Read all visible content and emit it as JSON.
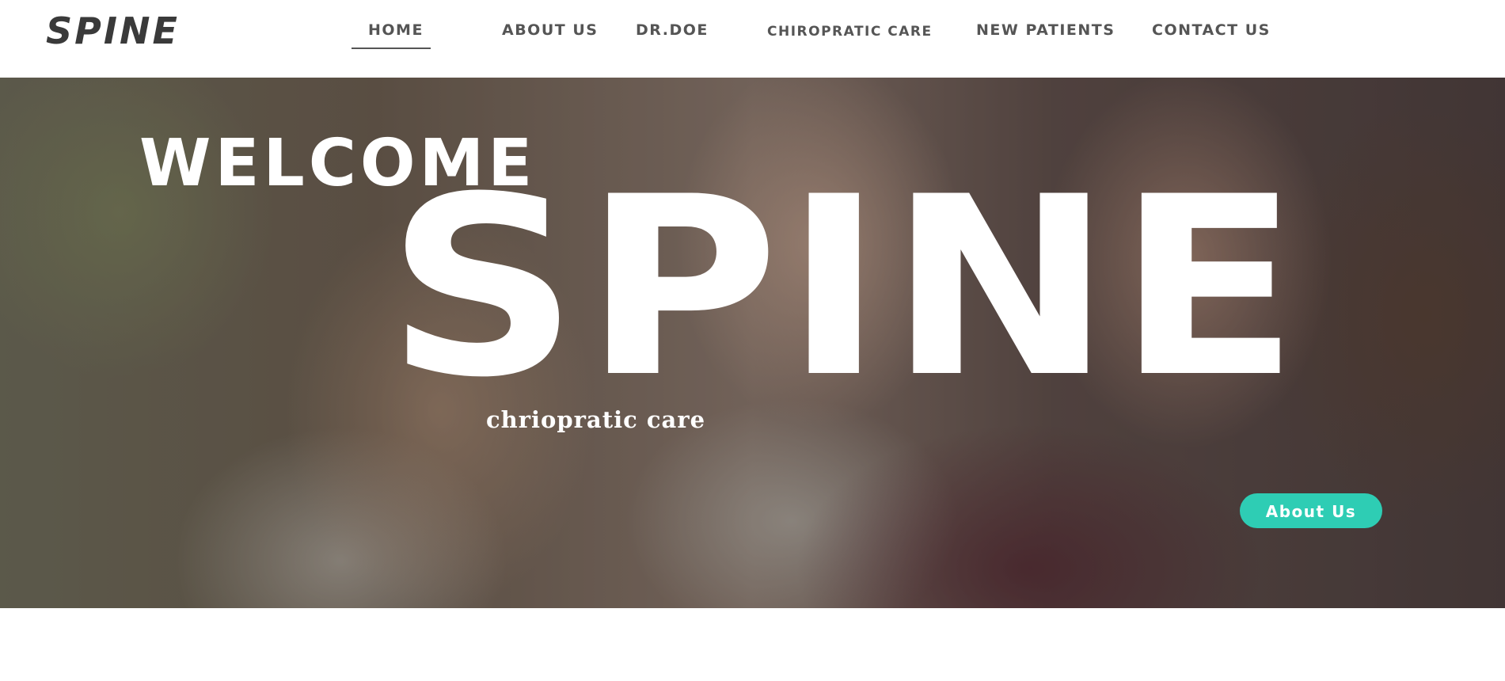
{
  "header": {
    "logo": "SPINE",
    "nav": [
      {
        "label": "HOME"
      },
      {
        "label": "ABOUT US"
      },
      {
        "label": "DR.DOE"
      },
      {
        "label": "CHIROPRATIC CARE"
      },
      {
        "label": "NEW PATIENTS"
      },
      {
        "label": "CONTACT US"
      }
    ]
  },
  "hero": {
    "welcome": "WELCOME",
    "title": "SPINE",
    "subtitle": "chriopratic care",
    "button_label": "About Us"
  },
  "colors": {
    "accent": "#2ecdb4",
    "nav_text": "#555555",
    "logo": "#3a3a3a"
  }
}
